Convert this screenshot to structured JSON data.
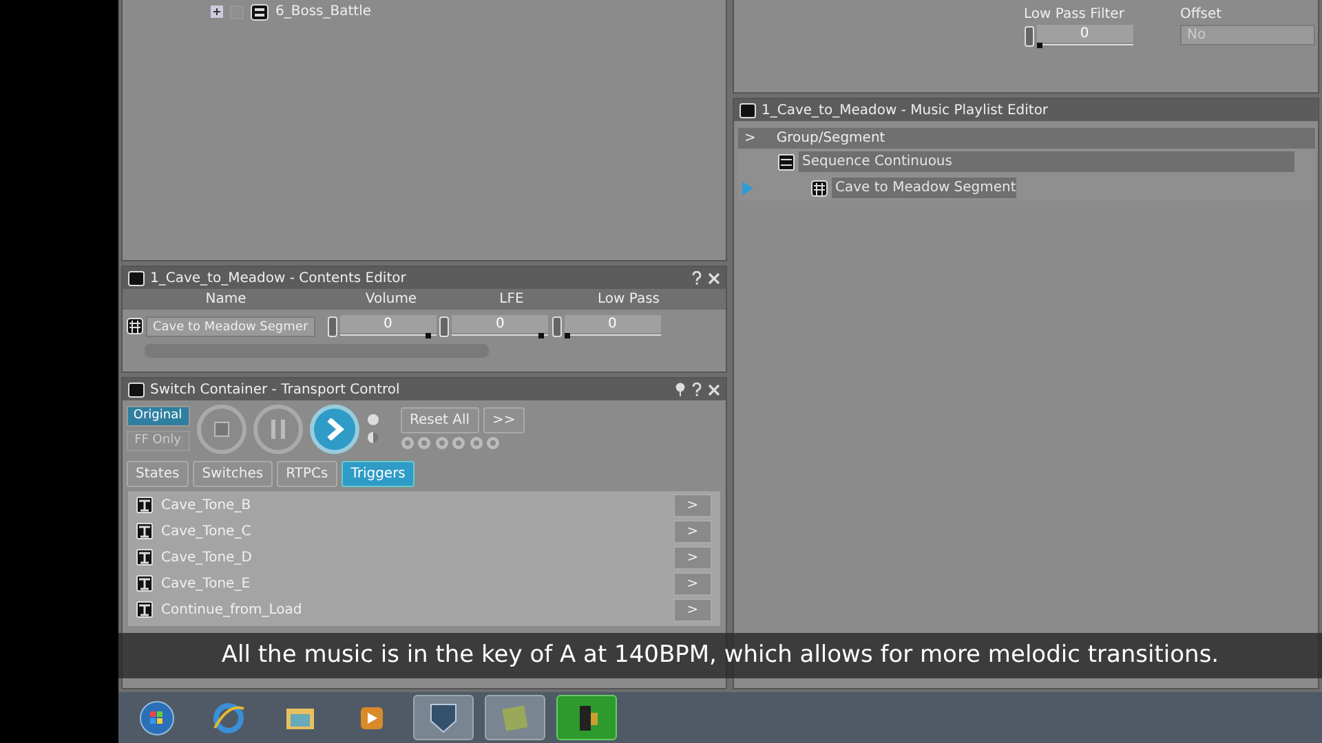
{
  "tree": {
    "items": [
      {
        "label": "6_Boss_Battle",
        "expanded": false,
        "checked": false
      }
    ]
  },
  "properties": {
    "low_pass_filter": {
      "label": "Low Pass Filter",
      "value": "0",
      "level": 0
    },
    "offset": {
      "label": "Offset",
      "value": "No"
    }
  },
  "playlist_editor": {
    "title": "1_Cave_to_Meadow - Music Playlist Editor",
    "header": {
      "toggle": ">",
      "column": "Group/Segment"
    },
    "items": [
      {
        "label": "Sequence Continuous",
        "kind": "group",
        "playing": false,
        "children": [
          {
            "label": "Cave to Meadow Segment",
            "kind": "segment",
            "playing": true
          }
        ]
      }
    ]
  },
  "contents_editor": {
    "title": "1_Cave_to_Meadow - Contents Editor",
    "columns": [
      "Name",
      "Volume",
      "LFE",
      "Low Pass"
    ],
    "rows": [
      {
        "name": "Cave to Meadow Segmer",
        "sliders": [
          {
            "value": "0",
            "level": 0.95
          },
          {
            "value": "0",
            "level": 0.95
          },
          {
            "value": "0",
            "level": 0
          }
        ]
      }
    ]
  },
  "transport": {
    "title": "Switch Container - Transport Control",
    "modes": [
      {
        "label": "Original",
        "on": true
      },
      {
        "label": "FF Only",
        "on": false
      }
    ],
    "buttons": [
      "Reset All",
      ">>"
    ],
    "tabs": [
      {
        "label": "States",
        "selected": false
      },
      {
        "label": "Switches",
        "selected": false
      },
      {
        "label": "RTPCs",
        "selected": false
      },
      {
        "label": "Triggers",
        "selected": true
      }
    ],
    "triggers": [
      {
        "label": "Cave_Tone_B",
        "action": ">"
      },
      {
        "label": "Cave_Tone_C",
        "action": ">"
      },
      {
        "label": "Cave_Tone_D",
        "action": ">"
      },
      {
        "label": "Cave_Tone_E",
        "action": ">"
      },
      {
        "label": "Continue_from_Load",
        "action": ">"
      }
    ]
  },
  "caption": "All the music is in the key of A at 140BPM, which allows for more melodic transitions.",
  "taskbar": {
    "apps": [
      {
        "kind": "start",
        "selected": false
      },
      {
        "kind": "browser",
        "selected": false
      },
      {
        "kind": "folder",
        "selected": false
      },
      {
        "kind": "media",
        "selected": false
      },
      {
        "kind": "shield",
        "selected": false
      },
      {
        "kind": "note",
        "selected": false
      },
      {
        "kind": "camera",
        "selected": true
      }
    ]
  }
}
